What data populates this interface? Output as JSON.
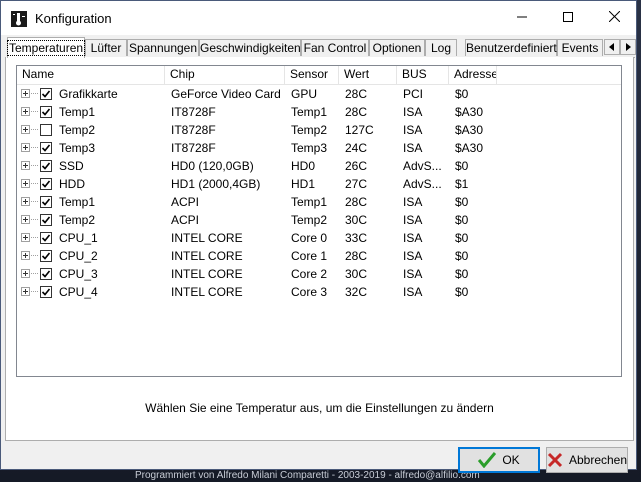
{
  "window": {
    "title": "Konfiguration"
  },
  "background": {
    "footer_text": "Programmiert von Alfredo Milani Comparetti - 2003-2019 - alfredo@alfilio.com"
  },
  "tabs": [
    {
      "label": "Temperaturen",
      "active": true
    },
    {
      "label": "Lüfter",
      "active": false
    },
    {
      "label": "Spannungen",
      "active": false
    },
    {
      "label": "Geschwindigkeiten",
      "active": false
    },
    {
      "label": "Fan Control",
      "active": false
    },
    {
      "label": "Optionen",
      "active": false
    },
    {
      "label": "Log",
      "active": false
    },
    {
      "label": "Benutzerdefiniert",
      "active": false
    },
    {
      "label": "Events",
      "active": false
    }
  ],
  "table": {
    "columns": [
      "Name",
      "Chip",
      "Sensor",
      "Wert",
      "BUS",
      "Adresse"
    ],
    "rows": [
      {
        "checked": true,
        "name": "Grafikkarte",
        "chip": "GeForce Video Card",
        "sensor": "GPU",
        "wert": "28C",
        "bus": "PCI",
        "adresse": "$0"
      },
      {
        "checked": true,
        "name": "Temp1",
        "chip": "IT8728F",
        "sensor": "Temp1",
        "wert": "28C",
        "bus": "ISA",
        "adresse": "$A30"
      },
      {
        "checked": false,
        "name": "Temp2",
        "chip": "IT8728F",
        "sensor": "Temp2",
        "wert": "127C",
        "bus": "ISA",
        "adresse": "$A30"
      },
      {
        "checked": true,
        "name": "Temp3",
        "chip": "IT8728F",
        "sensor": "Temp3",
        "wert": "24C",
        "bus": "ISA",
        "adresse": "$A30"
      },
      {
        "checked": true,
        "name": "SSD",
        "chip": "HD0 (120,0GB)",
        "sensor": "HD0",
        "wert": "26C",
        "bus": "AdvS...",
        "adresse": "$0"
      },
      {
        "checked": true,
        "name": "HDD",
        "chip": "HD1 (2000,4GB)",
        "sensor": "HD1",
        "wert": "27C",
        "bus": "AdvS...",
        "adresse": "$1"
      },
      {
        "checked": true,
        "name": "Temp1",
        "chip": "ACPI",
        "sensor": "Temp1",
        "wert": "28C",
        "bus": "ISA",
        "adresse": "$0"
      },
      {
        "checked": true,
        "name": "Temp2",
        "chip": "ACPI",
        "sensor": "Temp2",
        "wert": "30C",
        "bus": "ISA",
        "adresse": "$0"
      },
      {
        "checked": true,
        "name": "CPU_1",
        "chip": "INTEL CORE",
        "sensor": "Core 0",
        "wert": "33C",
        "bus": "ISA",
        "adresse": "$0"
      },
      {
        "checked": true,
        "name": "CPU_2",
        "chip": "INTEL CORE",
        "sensor": "Core 1",
        "wert": "28C",
        "bus": "ISA",
        "adresse": "$0"
      },
      {
        "checked": true,
        "name": "CPU_3",
        "chip": "INTEL CORE",
        "sensor": "Core 2",
        "wert": "30C",
        "bus": "ISA",
        "adresse": "$0"
      },
      {
        "checked": true,
        "name": "CPU_4",
        "chip": "INTEL CORE",
        "sensor": "Core 3",
        "wert": "32C",
        "bus": "ISA",
        "adresse": "$0"
      }
    ]
  },
  "hint": "Wählen Sie eine Temperatur aus, um die Einstellungen zu ändern",
  "buttons": {
    "ok": "OK",
    "cancel": "Abbrechen"
  },
  "icons": {
    "window": "thermometer-icon",
    "ok": "green-check-icon",
    "cancel": "red-x-icon"
  },
  "colors": {
    "ok_check": "#2a9d2a",
    "cancel_x": "#c62828",
    "focus_border": "#0078d7"
  }
}
